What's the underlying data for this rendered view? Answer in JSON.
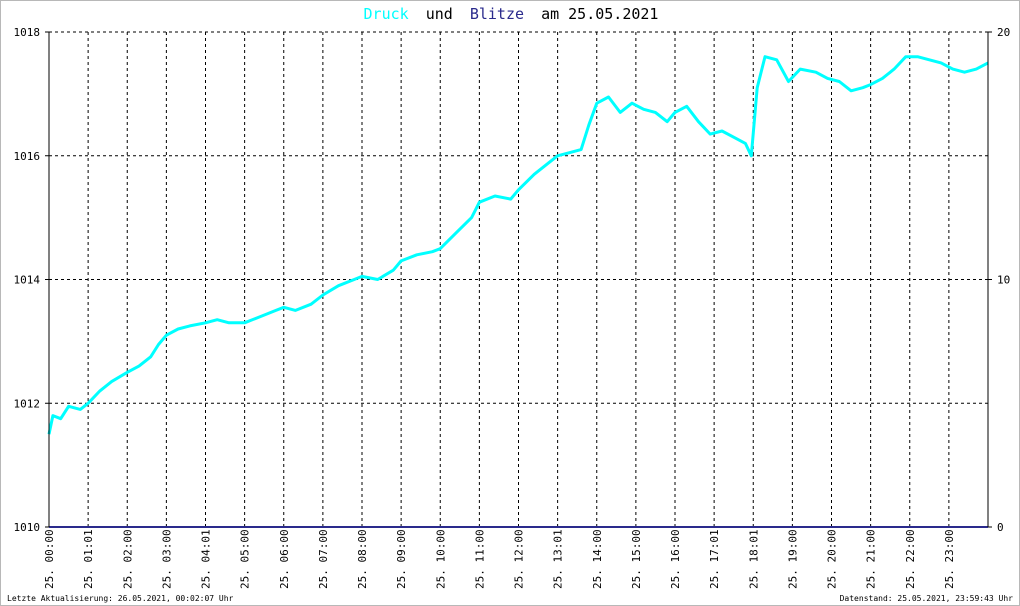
{
  "title": {
    "series1": "Druck",
    "connector": "und",
    "series2": "Blitze",
    "suffix": "am 25.05.2021"
  },
  "footer": {
    "left": "Letzte Aktualisierung: 26.05.2021, 00:02:07 Uhr",
    "right": "Datenstand: 25.05.2021, 23:59:43 Uhr"
  },
  "colors": {
    "druck": "#00ffff",
    "blitze": "#2a2a8c",
    "grid": "#000000",
    "title_black": "#000000"
  },
  "chart_data": {
    "type": "line",
    "x_unit": "hour of day",
    "xlim": [
      0,
      24
    ],
    "x_ticks": [
      {
        "hour": 0,
        "label": "25. 00:00"
      },
      {
        "hour": 1,
        "label": "25. 01:01"
      },
      {
        "hour": 2,
        "label": "25. 02:00"
      },
      {
        "hour": 3,
        "label": "25. 03:00"
      },
      {
        "hour": 4,
        "label": "25. 04:01"
      },
      {
        "hour": 5,
        "label": "25. 05:00"
      },
      {
        "hour": 6,
        "label": "25. 06:00"
      },
      {
        "hour": 7,
        "label": "25. 07:00"
      },
      {
        "hour": 8,
        "label": "25. 08:00"
      },
      {
        "hour": 9,
        "label": "25. 09:00"
      },
      {
        "hour": 10,
        "label": "25. 10:00"
      },
      {
        "hour": 11,
        "label": "25. 11:00"
      },
      {
        "hour": 12,
        "label": "25. 12:00"
      },
      {
        "hour": 13,
        "label": "25. 13:01"
      },
      {
        "hour": 14,
        "label": "25. 14:00"
      },
      {
        "hour": 15,
        "label": "25. 15:00"
      },
      {
        "hour": 16,
        "label": "25. 16:00"
      },
      {
        "hour": 17,
        "label": "25. 17:01"
      },
      {
        "hour": 18,
        "label": "25. 18:01"
      },
      {
        "hour": 19,
        "label": "25. 19:00"
      },
      {
        "hour": 20,
        "label": "25. 20:00"
      },
      {
        "hour": 21,
        "label": "25. 21:00"
      },
      {
        "hour": 22,
        "label": "25. 22:00"
      },
      {
        "hour": 23,
        "label": "25. 23:00"
      }
    ],
    "y_left": {
      "lim": [
        1010,
        1018
      ],
      "ticks": [
        1010,
        1012,
        1014,
        1016,
        1018
      ]
    },
    "y_right": {
      "lim": [
        0,
        20
      ],
      "ticks": [
        0,
        10,
        20
      ]
    },
    "grid": true,
    "series": [
      {
        "name": "Druck",
        "axis": "left",
        "color": "#00ffff",
        "points": [
          [
            0.0,
            1011.5
          ],
          [
            0.1,
            1011.8
          ],
          [
            0.3,
            1011.75
          ],
          [
            0.5,
            1011.95
          ],
          [
            0.8,
            1011.9
          ],
          [
            1.0,
            1012.0
          ],
          [
            1.3,
            1012.2
          ],
          [
            1.6,
            1012.35
          ],
          [
            2.0,
            1012.5
          ],
          [
            2.3,
            1012.6
          ],
          [
            2.6,
            1012.75
          ],
          [
            2.8,
            1012.95
          ],
          [
            3.0,
            1013.1
          ],
          [
            3.3,
            1013.2
          ],
          [
            3.6,
            1013.25
          ],
          [
            4.0,
            1013.3
          ],
          [
            4.3,
            1013.35
          ],
          [
            4.6,
            1013.3
          ],
          [
            5.0,
            1013.3
          ],
          [
            5.4,
            1013.4
          ],
          [
            5.8,
            1013.5
          ],
          [
            6.0,
            1013.55
          ],
          [
            6.3,
            1013.5
          ],
          [
            6.7,
            1013.6
          ],
          [
            7.0,
            1013.75
          ],
          [
            7.4,
            1013.9
          ],
          [
            7.8,
            1014.0
          ],
          [
            8.0,
            1014.05
          ],
          [
            8.4,
            1014.0
          ],
          [
            8.8,
            1014.15
          ],
          [
            9.0,
            1014.3
          ],
          [
            9.4,
            1014.4
          ],
          [
            9.8,
            1014.45
          ],
          [
            10.0,
            1014.5
          ],
          [
            10.4,
            1014.75
          ],
          [
            10.8,
            1015.0
          ],
          [
            11.0,
            1015.25
          ],
          [
            11.4,
            1015.35
          ],
          [
            11.8,
            1015.3
          ],
          [
            12.0,
            1015.45
          ],
          [
            12.4,
            1015.7
          ],
          [
            12.8,
            1015.9
          ],
          [
            13.0,
            1016.0
          ],
          [
            13.3,
            1016.05
          ],
          [
            13.6,
            1016.1
          ],
          [
            13.8,
            1016.5
          ],
          [
            14.0,
            1016.85
          ],
          [
            14.3,
            1016.95
          ],
          [
            14.6,
            1016.7
          ],
          [
            14.9,
            1016.85
          ],
          [
            15.2,
            1016.75
          ],
          [
            15.5,
            1016.7
          ],
          [
            15.8,
            1016.55
          ],
          [
            16.0,
            1016.7
          ],
          [
            16.3,
            1016.8
          ],
          [
            16.6,
            1016.55
          ],
          [
            16.9,
            1016.35
          ],
          [
            17.2,
            1016.4
          ],
          [
            17.5,
            1016.3
          ],
          [
            17.8,
            1016.2
          ],
          [
            17.95,
            1016.0
          ],
          [
            18.1,
            1017.1
          ],
          [
            18.3,
            1017.6
          ],
          [
            18.6,
            1017.55
          ],
          [
            18.9,
            1017.2
          ],
          [
            19.2,
            1017.4
          ],
          [
            19.6,
            1017.35
          ],
          [
            19.9,
            1017.25
          ],
          [
            20.2,
            1017.2
          ],
          [
            20.5,
            1017.05
          ],
          [
            20.8,
            1017.1
          ],
          [
            21.0,
            1017.15
          ],
          [
            21.3,
            1017.25
          ],
          [
            21.6,
            1017.4
          ],
          [
            21.9,
            1017.6
          ],
          [
            22.2,
            1017.6
          ],
          [
            22.5,
            1017.55
          ],
          [
            22.8,
            1017.5
          ],
          [
            23.1,
            1017.4
          ],
          [
            23.4,
            1017.35
          ],
          [
            23.7,
            1017.4
          ],
          [
            24.0,
            1017.5
          ]
        ]
      },
      {
        "name": "Blitze",
        "axis": "right",
        "color": "#2a2a8c",
        "points": [
          [
            0,
            0
          ],
          [
            24,
            0
          ]
        ]
      }
    ]
  }
}
